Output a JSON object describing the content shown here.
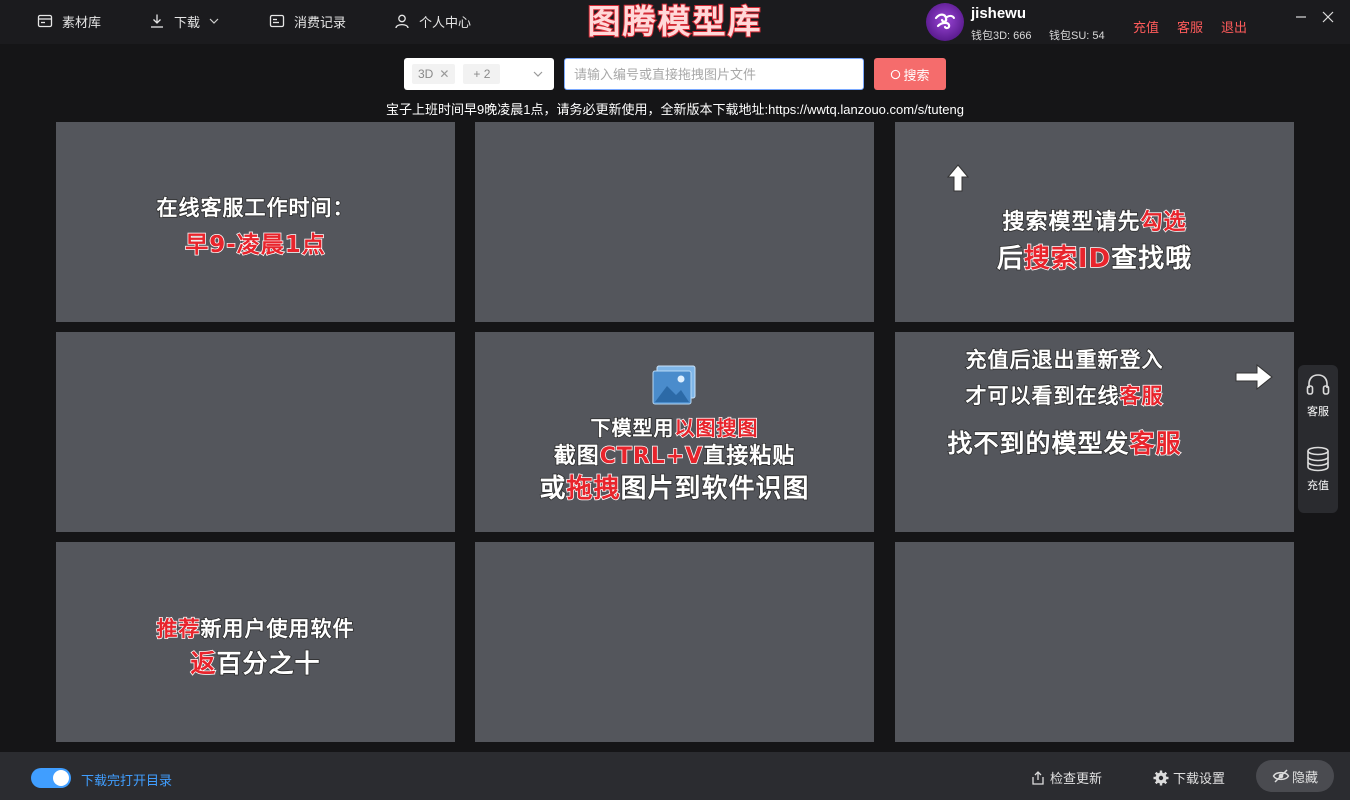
{
  "nav": {
    "items": [
      {
        "label": "素材库",
        "icon": "card-icon"
      },
      {
        "label": "下载",
        "icon": "download-icon"
      },
      {
        "label": "消费记录",
        "icon": "receipt-icon"
      },
      {
        "label": "个人中心",
        "icon": "user-icon"
      }
    ]
  },
  "app_title": "图腾模型库",
  "user": {
    "name": "jishewu",
    "wallet_3d": "钱包3D: 666",
    "wallet_su": "钱包SU: 54"
  },
  "top_links": {
    "recharge": "充值",
    "service": "客服",
    "logout": "退出"
  },
  "search": {
    "filter_tag": "3D",
    "filter_more": "+ 2",
    "placeholder": "请输入编号或直接拖拽图片文件",
    "button_label": "搜索"
  },
  "notice": "宝子上班时间早9晚凌晨1点，请务必更新使用，全新版本下载地址:https://wwtq.lanzouo.com/s/tuteng",
  "tiles": {
    "t1": {
      "line1": "在线客服工作时间：",
      "line2": "早9-凌晨1点"
    },
    "t3": {
      "line1a": "搜索模型请先",
      "line1b": "勾选",
      "line2a": "后",
      "line2b": "搜索ID",
      "line2c": "查找哦"
    },
    "t5": {
      "line1a": "下模型用",
      "line1b": "以图搜图",
      "line2a": "截图",
      "line2b": "CTRL+V",
      "line2c": "直接粘贴",
      "line3a": "或",
      "line3b": "拖拽",
      "line3c": "图片到软件识图"
    },
    "t6": {
      "line1": "充值后退出重新登入",
      "line2a": "才可以看到在线",
      "line2b": "客服",
      "line3a": "找不到的模型发",
      "line3b": "客服"
    },
    "t7": {
      "line1a": "推荐",
      "line1b": "新用户使用软件",
      "line2a": "返",
      "line2b": "百分之十"
    }
  },
  "side": {
    "service": "客服",
    "recharge": "充值"
  },
  "footer": {
    "toggle_label": "下载完打开目录",
    "toggle_on": true,
    "check_update": "检查更新",
    "download_settings": "下载设置",
    "hide": "隐藏"
  },
  "colors": {
    "accent_red": "#f56c6c",
    "link_red": "#ff5b5b",
    "toggle_blue": "#409eff",
    "tile_bg": "#54565c"
  }
}
